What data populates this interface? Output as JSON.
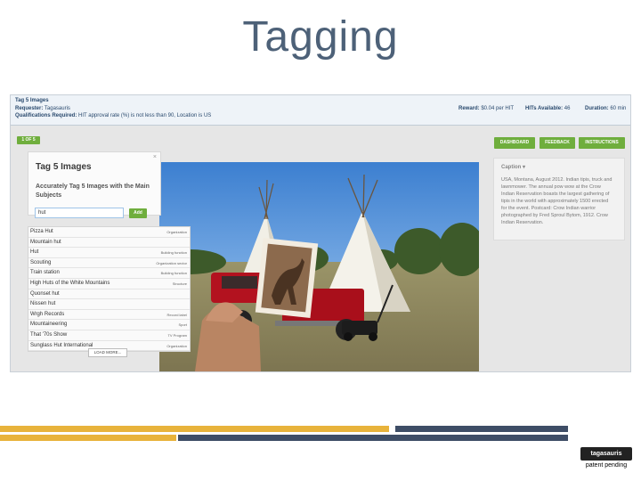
{
  "slide": {
    "title": "Tagging"
  },
  "hit": {
    "title": "Tag 5 Images",
    "requester_label": "Requester:",
    "requester": "Tagasauris",
    "qualifications_label": "Qualifications Required:",
    "qualifications": "HIT approval rate (%) is not less than 90, Location is US",
    "reward_label": "Reward:",
    "reward": "$0.04 per HIT",
    "hits_label": "HITs Available:",
    "hits": "46",
    "duration_label": "Duration:",
    "duration": "60 min"
  },
  "toolbar": {
    "pager": "1 OF 5",
    "dashboard": "DASHBOARD",
    "feedback": "FEEDBACK",
    "instructions": "INSTRUCTIONS"
  },
  "tag_panel": {
    "close": "×",
    "title": "Tag 5 Images",
    "subtitle": "Accurately Tag 5 Images with the Main Subjects",
    "input_value": "hut",
    "add_label": "Add"
  },
  "suggestions": [
    {
      "name": "Pizza Hut",
      "type": "Organization"
    },
    {
      "name": "Mountain hut",
      "type": ""
    },
    {
      "name": "Hut",
      "type": "Building function"
    },
    {
      "name": "Scouting",
      "type": "Organization sector"
    },
    {
      "name": "Train station",
      "type": "Building function"
    },
    {
      "name": "High Huts of the White Mountains",
      "type": "Structure"
    },
    {
      "name": "Quonset hut",
      "type": ""
    },
    {
      "name": "Nissen hut",
      "type": ""
    },
    {
      "name": "Wrgh Records",
      "type": "Record label"
    },
    {
      "name": "Mountaineering",
      "type": "Sport"
    },
    {
      "name": "That '70s Show",
      "type": "TV Program"
    },
    {
      "name": "Sunglass Hut International",
      "type": "Organization"
    }
  ],
  "load_more": "LOAD MORE...",
  "caption": {
    "title": "Caption ▾",
    "text": "USA, Montana, August 2012. Indian tipis, truck and lawnmower. The annual pow wow at the Crow Indian Reservation boasts the largest gathering of tipis in the world with approximately 1500 erected for the event. Postcard: Crow Indian warrior photographed by Fred Sproul Bytom, 1912. Crow Indian Reservation."
  },
  "footer": {
    "logo": "tagasauris",
    "patent": "patent pending"
  },
  "colors": {
    "accent_green": "#6fae3d",
    "bar_gold": "#e8b33b",
    "bar_navy": "#3e4d66"
  }
}
